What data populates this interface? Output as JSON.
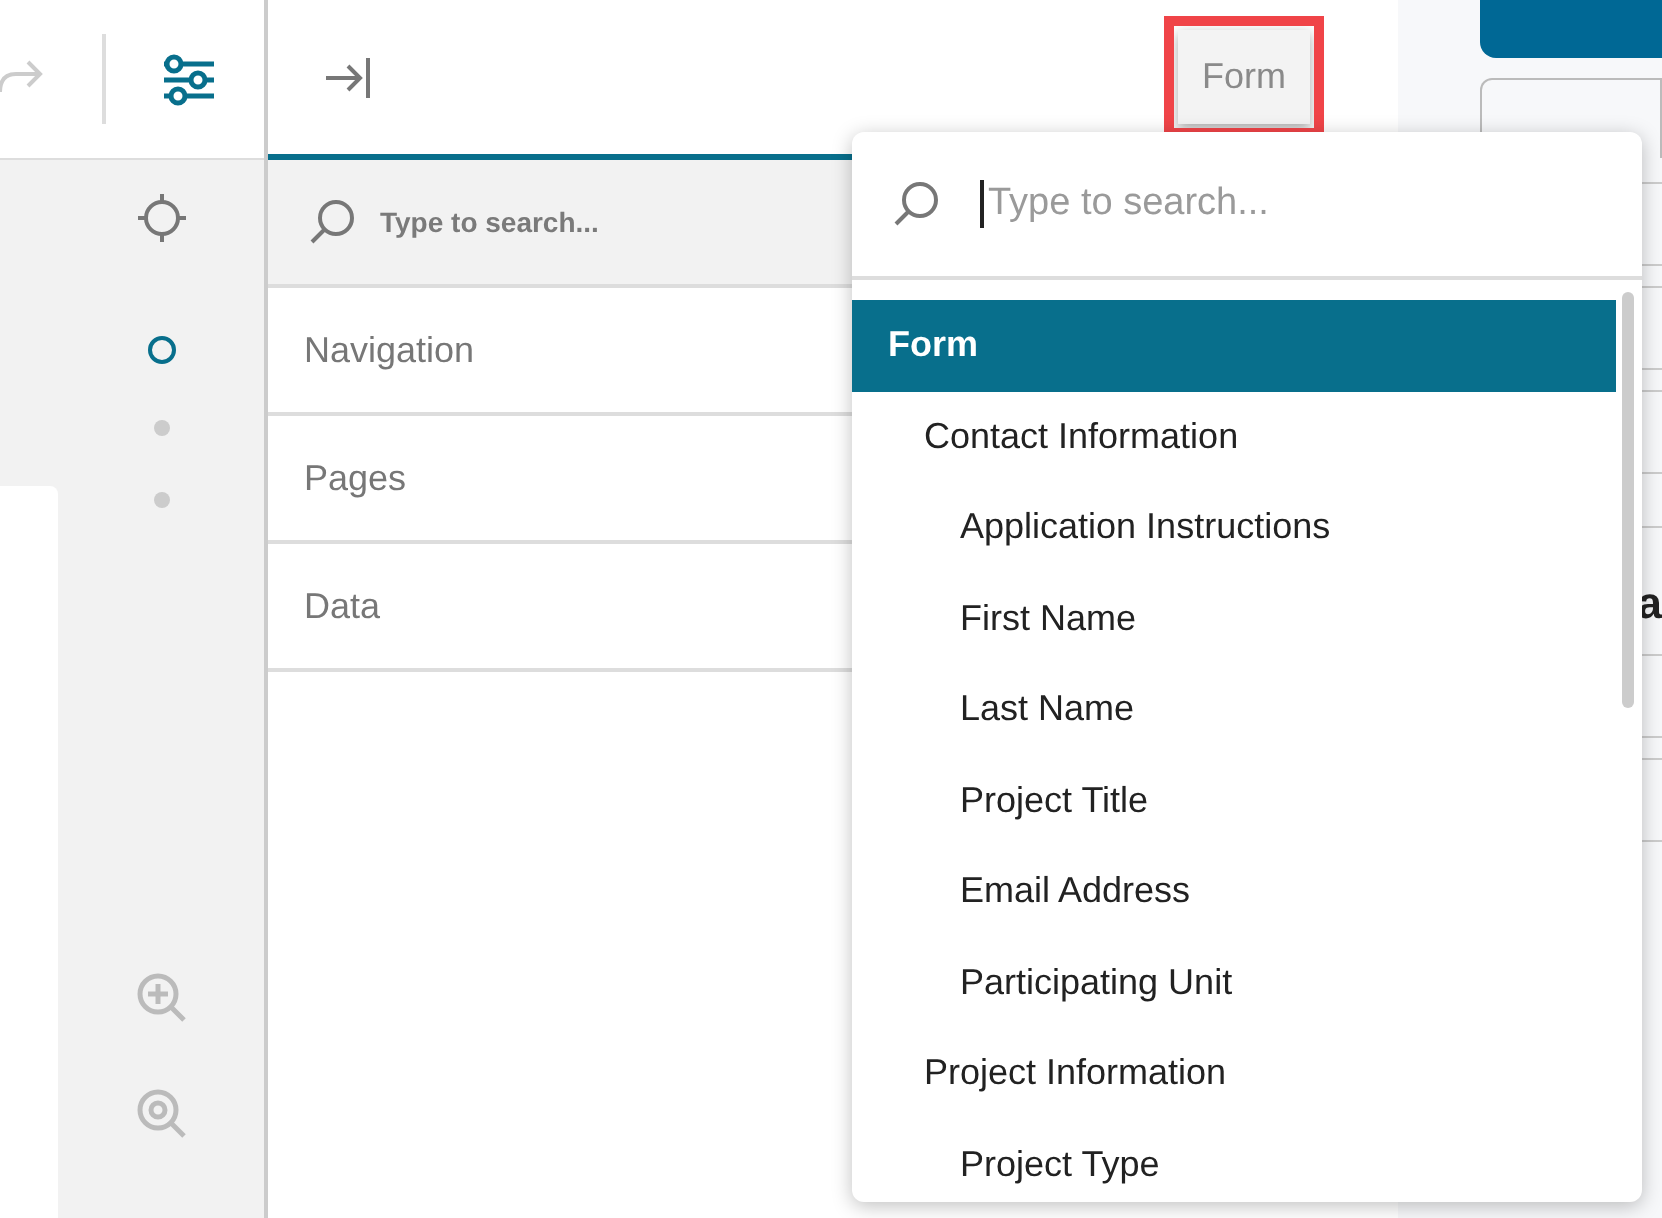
{
  "rail_steps": [
    {
      "selected": true
    },
    {
      "selected": false
    },
    {
      "selected": false
    }
  ],
  "panel": {
    "form_button": {
      "label": "Form",
      "highlighted": true
    },
    "search": {
      "placeholder": "Type to search..."
    },
    "items": [
      {
        "label": "Navigation"
      },
      {
        "label": "Pages"
      },
      {
        "label": "Data"
      }
    ]
  },
  "background_text": "a",
  "dropdown": {
    "search": {
      "placeholder": "Type to search...",
      "focused": true
    },
    "tree": [
      {
        "label": "Form",
        "selected": true,
        "children": [
          {
            "label": "Contact Information",
            "selected": false,
            "children": [
              {
                "label": "Application Instructions",
                "selected": false
              },
              {
                "label": "First Name",
                "selected": false
              },
              {
                "label": "Last Name",
                "selected": false
              },
              {
                "label": "Project Title",
                "selected": false
              },
              {
                "label": "Email Address",
                "selected": false
              },
              {
                "label": "Participating Unit",
                "selected": false
              }
            ]
          },
          {
            "label": "Project Information",
            "selected": false,
            "children": [
              {
                "label": "Project Type",
                "selected": false
              }
            ]
          }
        ]
      }
    ]
  }
}
